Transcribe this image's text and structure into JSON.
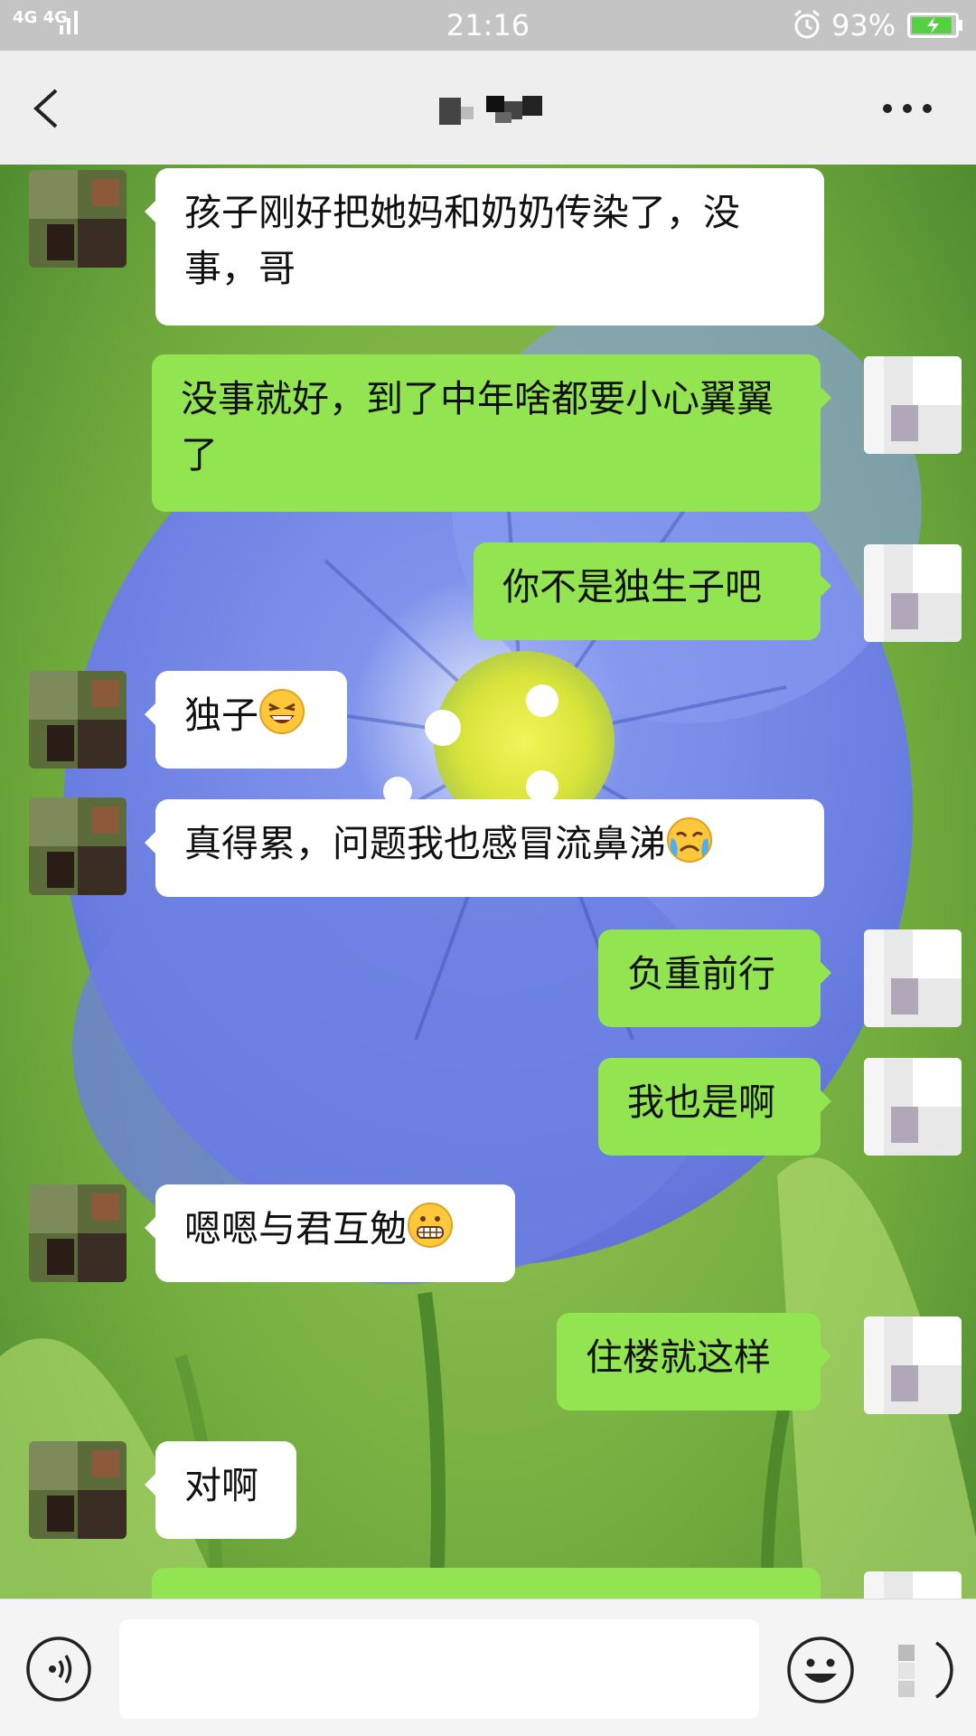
{
  "status_bar": {
    "network": "4G 4G",
    "time": "21:16",
    "battery_percent": "93%",
    "battery_level": 0.93
  },
  "header": {
    "back_icon": "back-chevron-icon",
    "title": "",
    "more_icon": "more-dots-icon"
  },
  "messages": [
    {
      "side": "in",
      "text": "孩子刚好把她妈和奶奶传染了，没事，哥",
      "emoji": ""
    },
    {
      "side": "out",
      "text": "没事就好，到了中年啥都要小心翼翼了",
      "emoji": ""
    },
    {
      "side": "out",
      "text": "你不是独生子吧",
      "emoji": ""
    },
    {
      "side": "in",
      "text": "独子",
      "emoji": "grinning-squint-emoji"
    },
    {
      "side": "in",
      "text": "真得累，问题我也感冒流鼻涕",
      "emoji": "crying-emoji"
    },
    {
      "side": "out",
      "text": "负重前行",
      "emoji": ""
    },
    {
      "side": "out",
      "text": "我也是啊",
      "emoji": ""
    },
    {
      "side": "in",
      "text": "嗯嗯与君互勉",
      "emoji": "grimacing-emoji"
    },
    {
      "side": "out",
      "text": "住楼就这样",
      "emoji": ""
    },
    {
      "side": "in",
      "text": "对啊",
      "emoji": ""
    }
  ],
  "input_bar": {
    "voice_icon": "voice-icon",
    "placeholder": "",
    "emoji_icon": "emoji-face-icon",
    "plus_icon": "plus-icon"
  },
  "colors": {
    "outgoing_bubble": "#92e450",
    "incoming_bubble": "#ffffff",
    "status_bar": "#c4c4c4",
    "title_bar": "#eeeeee"
  }
}
